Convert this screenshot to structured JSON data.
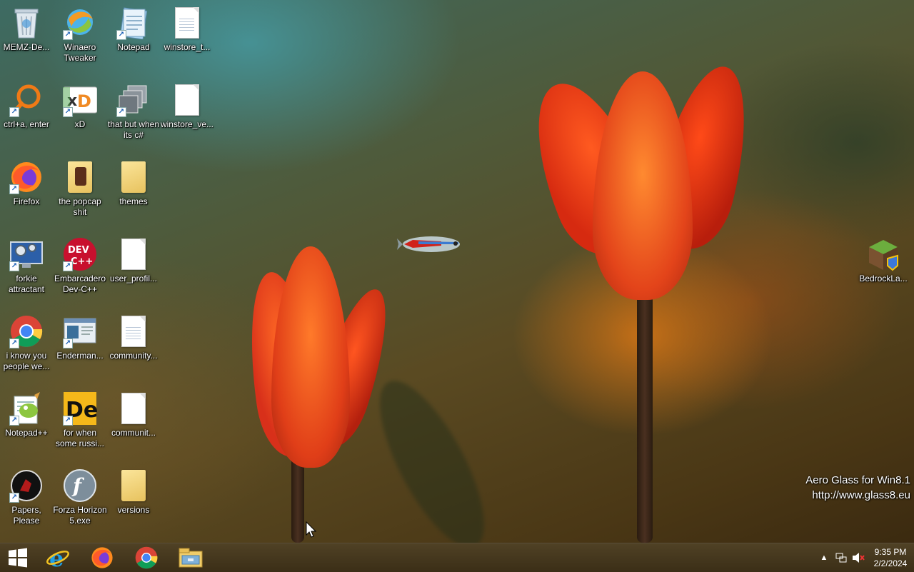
{
  "desktop": {
    "icons": [
      {
        "label": "MEMZ-De...",
        "icon": "recycle-bin-icon"
      },
      {
        "label": "Winaero Tweaker",
        "icon": "winaero-icon"
      },
      {
        "label": "Notepad",
        "icon": "notepad-icon"
      },
      {
        "label": "winstore_t...",
        "icon": "text-file-icon"
      },
      {
        "label": "ctrl+a, enter",
        "icon": "magnifier-icon"
      },
      {
        "label": "xD",
        "icon": "hxd-icon"
      },
      {
        "label": "that but when its c#",
        "icon": "windows-stack-icon"
      },
      {
        "label": "winstore_ve...",
        "icon": "blank-file-icon"
      },
      {
        "label": "Firefox",
        "icon": "firefox-icon"
      },
      {
        "label": "the popcap shit",
        "icon": "folder-icon"
      },
      {
        "label": "themes",
        "icon": "folder-icon"
      },
      {
        "label": "forkie attractant",
        "icon": "monitor-gear-icon"
      },
      {
        "label": "Embarcadero Dev-C++",
        "icon": "devcpp-icon"
      },
      {
        "label": "user_profil...",
        "icon": "blank-file-icon"
      },
      {
        "label": "i know you people we...",
        "icon": "chrome-icon"
      },
      {
        "label": "Enderman...",
        "icon": "window-thumbnail-icon"
      },
      {
        "label": "community...",
        "icon": "text-file-icon"
      },
      {
        "label": "Notepad++",
        "icon": "notepadpp-icon"
      },
      {
        "label": "for when some russi...",
        "icon": "de-icon"
      },
      {
        "label": "communit...",
        "icon": "blank-file-icon"
      },
      {
        "label": "Papers, Please",
        "icon": "papers-please-icon"
      },
      {
        "label": "Forza Horizon 5.exe",
        "icon": "flash-icon"
      },
      {
        "label": "versions",
        "icon": "folder-icon"
      },
      {
        "label": "BedrockLa...",
        "icon": "minecraft-block-icon"
      }
    ],
    "watermark": {
      "line1": "Aero Glass for Win8.1",
      "line2": "http://www.glass8.eu"
    }
  },
  "taskbar": {
    "pinned": [
      {
        "name": "start-button"
      },
      {
        "name": "internet-explorer-icon"
      },
      {
        "name": "firefox-icon"
      },
      {
        "name": "chrome-icon"
      },
      {
        "name": "file-explorer-icon"
      }
    ],
    "clock": {
      "time": "9:35 PM",
      "date": "2/2/2024"
    }
  }
}
